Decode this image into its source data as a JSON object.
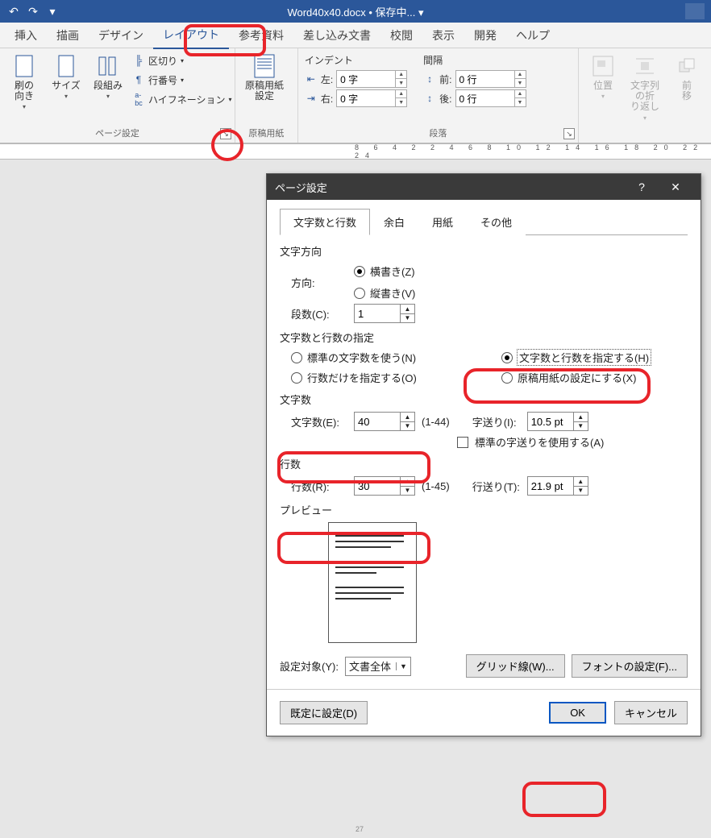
{
  "titlebar": {
    "doc": "Word40x40.docx • 保存中... ▾"
  },
  "tabs": [
    "挿入",
    "描画",
    "デザイン",
    "レイアウト",
    "参考資料",
    "差し込み文書",
    "校閲",
    "表示",
    "開発",
    "ヘルプ"
  ],
  "active_tab_index": 3,
  "ribbon": {
    "page_setup": {
      "margins_label": "の\n向き",
      "size": "サイズ",
      "columns": "段組み",
      "section_break": "区切り",
      "line_numbers": "行番号",
      "hyphenation": "ハイフネーション",
      "group": "ページ設定"
    },
    "manuscript": {
      "btn": "原稿用紙\n設定",
      "group": "原稿用紙"
    },
    "paragraph": {
      "indent_label": "インデント",
      "indent_left_label": "左:",
      "indent_left_val": "0 字",
      "indent_right_label": "右:",
      "indent_right_val": "0 字",
      "spacing_label": "間隔",
      "before_label": "前:",
      "before_val": "0 行",
      "after_label": "後:",
      "after_val": "0 行",
      "group": "段落"
    },
    "arrange": {
      "pos": "位置",
      "wrap": "文字列の折\nり返し",
      "front": "前\n移"
    }
  },
  "ruler_text": "8  6  4  2      2  4  6  8  10  12  14  16  18  20  22  24",
  "dialog": {
    "title": "ページ設定",
    "tabs": [
      "文字数と行数",
      "余白",
      "用紙",
      "その他"
    ],
    "active_tab": 0,
    "section_direction": "文字方向",
    "direction_label": "方向:",
    "horizontal": "横書き(Z)",
    "vertical": "縦書き(V)",
    "columns_label": "段数(C):",
    "columns_val": "1",
    "section_spec": "文字数と行数の指定",
    "opt_standard": "標準の文字数を使う(N)",
    "opt_specify": "文字数と行数を指定する(H)",
    "opt_lines_only": "行数だけを指定する(O)",
    "opt_manuscript": "原稿用紙の設定にする(X)",
    "section_chars": "文字数",
    "chars_label": "文字数(E):",
    "chars_val": "40",
    "chars_range": "(1-44)",
    "char_pitch_label": "字送り(I):",
    "char_pitch_val": "10.5 pt",
    "std_pitch": "標準の字送りを使用する(A)",
    "section_lines": "行数",
    "lines_label": "行数(R):",
    "lines_val": "30",
    "lines_range": "(1-45)",
    "line_pitch_label": "行送り(T):",
    "line_pitch_val": "21.9 pt",
    "preview_label": "プレビュー",
    "apply_to_label": "設定対象(Y):",
    "apply_to_val": "文書全体",
    "gridlines_btn": "グリッド線(W)...",
    "font_btn": "フォントの設定(F)...",
    "default_btn": "既定に設定(D)",
    "ok": "OK",
    "cancel": "キャンセル"
  },
  "page_number": "27"
}
